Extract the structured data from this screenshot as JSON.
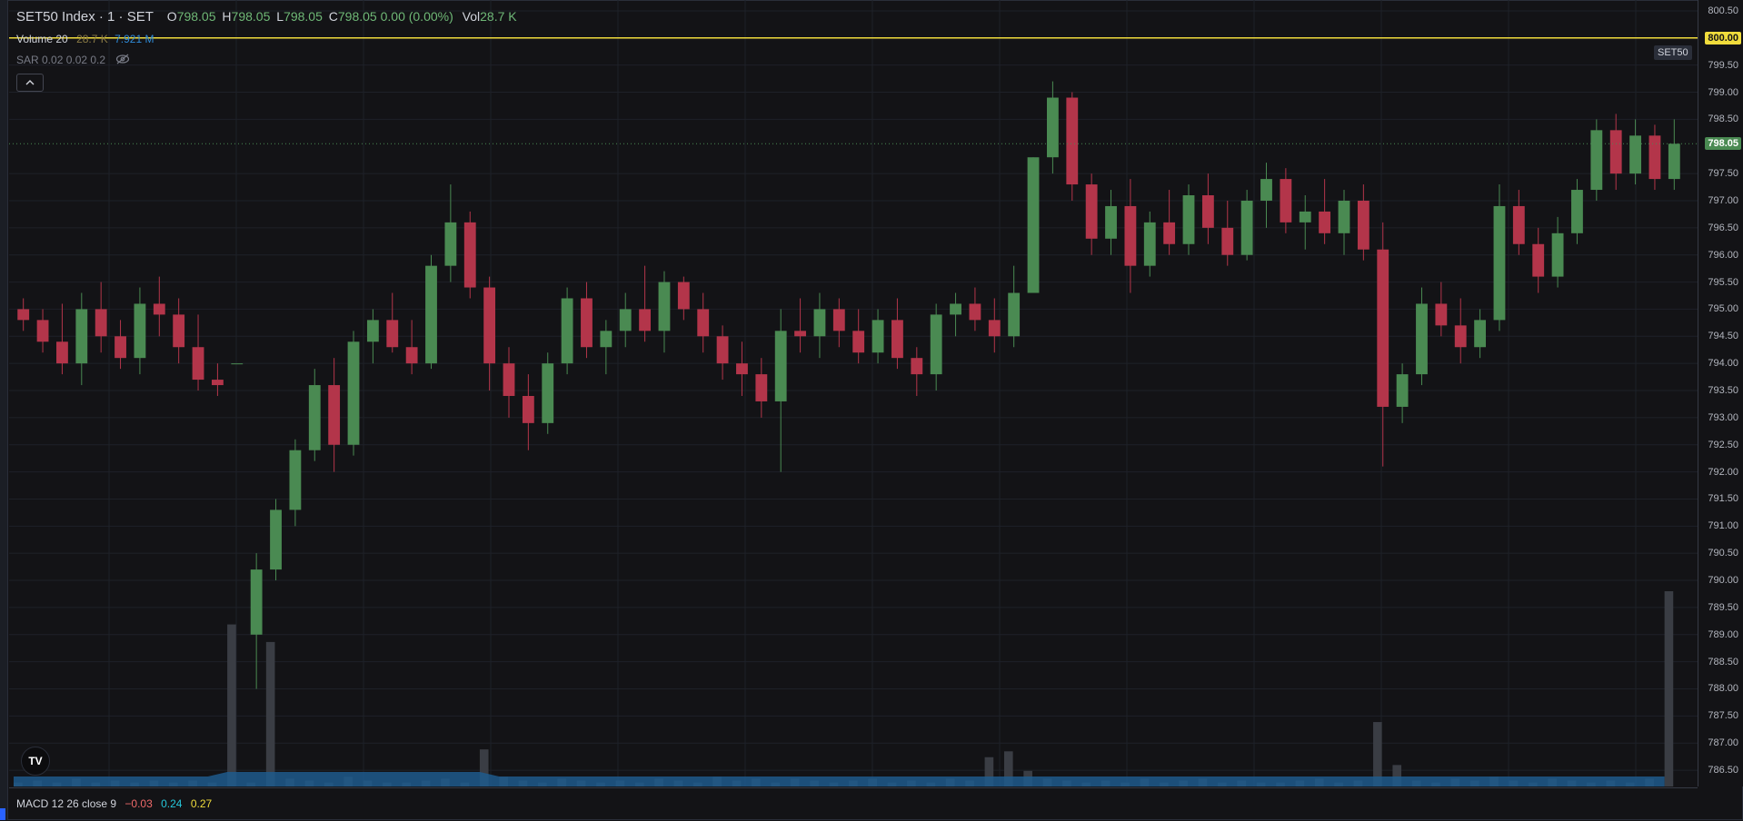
{
  "header": {
    "symbol": "SET50 Index · 1 · SET",
    "o_label": "O",
    "o_value": "798.05",
    "h_label": "H",
    "h_value": "798.05",
    "l_label": "L",
    "l_value": "798.05",
    "c_label": "C",
    "c_value": "798.05 0.00 (0.00%)",
    "vol_label": "Vol",
    "vol_value": "28.7 K"
  },
  "indicators": {
    "volume": {
      "label": "Volume 20",
      "value1": "28.7 K",
      "value2": "7.921 M"
    },
    "sar": {
      "label": "SAR 0.02 0.02 0.2",
      "icon": "eye-off-icon"
    },
    "collapse_icon": "chevron-up-icon",
    "macd": {
      "label": "MACD 12 26 close 9",
      "macd": "−0.03",
      "signal": "0.24",
      "histogram": "0.27"
    }
  },
  "symbol_badge": "SET50",
  "price_axis": {
    "ticks": [
      "800.50",
      "799.50",
      "799.00",
      "798.50",
      "797.50",
      "797.00",
      "796.50",
      "796.00",
      "795.50",
      "795.00",
      "794.50",
      "794.00",
      "793.50",
      "793.00",
      "792.50",
      "792.00",
      "791.50",
      "791.00",
      "790.50",
      "790.00",
      "789.50",
      "789.00",
      "788.50",
      "788.00",
      "787.50",
      "787.00",
      "786.50"
    ],
    "alert_price": "800.00",
    "last_price": "798.05"
  },
  "colors": {
    "background": "#131316",
    "up": "#4a8a52",
    "down": "#b3354a",
    "alert_line": "#f0dc3c",
    "volume_ma": "#1f5a8c",
    "volume_bar": "#3a3d44"
  },
  "logo": "TV",
  "chart_data": {
    "type": "candlestick",
    "interval": "1 minute",
    "yrange": [
      786.2,
      800.7
    ],
    "alert_level": 800.0,
    "last_close": 798.05,
    "candles_ohlc": [
      [
        795.0,
        795.2,
        794.6,
        794.8
      ],
      [
        794.8,
        795.0,
        794.2,
        794.4
      ],
      [
        794.4,
        795.1,
        793.8,
        794.0
      ],
      [
        794.0,
        795.3,
        793.6,
        795.0
      ],
      [
        795.0,
        795.5,
        794.2,
        794.5
      ],
      [
        794.5,
        794.8,
        793.9,
        794.1
      ],
      [
        794.1,
        795.4,
        793.8,
        795.1
      ],
      [
        795.1,
        795.6,
        794.5,
        794.9
      ],
      [
        794.9,
        795.2,
        794.0,
        794.3
      ],
      [
        794.3,
        794.9,
        793.5,
        793.7
      ],
      [
        793.7,
        794.0,
        793.4,
        793.6
      ],
      [
        794.0,
        794.0,
        794.0,
        794.0
      ],
      [
        789.0,
        790.5,
        788.0,
        790.2
      ],
      [
        790.2,
        791.5,
        790.0,
        791.3
      ],
      [
        791.3,
        792.6,
        791.0,
        792.4
      ],
      [
        792.4,
        793.9,
        792.2,
        793.6
      ],
      [
        793.6,
        794.1,
        792.0,
        792.5
      ],
      [
        792.5,
        794.6,
        792.3,
        794.4
      ],
      [
        794.4,
        795.0,
        794.0,
        794.8
      ],
      [
        794.8,
        795.3,
        794.2,
        794.3
      ],
      [
        794.3,
        794.8,
        793.8,
        794.0
      ],
      [
        794.0,
        796.0,
        793.9,
        795.8
      ],
      [
        795.8,
        797.3,
        795.5,
        796.6
      ],
      [
        796.6,
        796.8,
        795.2,
        795.4
      ],
      [
        795.4,
        795.6,
        793.5,
        794.0
      ],
      [
        794.0,
        794.3,
        793.0,
        793.4
      ],
      [
        793.4,
        793.8,
        792.4,
        792.9
      ],
      [
        792.9,
        794.2,
        792.7,
        794.0
      ],
      [
        794.0,
        795.4,
        793.8,
        795.2
      ],
      [
        795.2,
        795.5,
        794.1,
        794.3
      ],
      [
        794.3,
        794.8,
        793.8,
        794.6
      ],
      [
        794.6,
        795.3,
        794.3,
        795.0
      ],
      [
        795.0,
        795.8,
        794.4,
        794.6
      ],
      [
        794.6,
        795.7,
        794.2,
        795.5
      ],
      [
        795.5,
        795.6,
        794.8,
        795.0
      ],
      [
        795.0,
        795.3,
        794.2,
        794.5
      ],
      [
        794.5,
        794.7,
        793.7,
        794.0
      ],
      [
        794.0,
        794.4,
        793.4,
        793.8
      ],
      [
        793.8,
        794.1,
        793.0,
        793.3
      ],
      [
        793.3,
        795.0,
        792.0,
        794.6
      ],
      [
        794.6,
        795.2,
        794.2,
        794.5
      ],
      [
        794.5,
        795.3,
        794.1,
        795.0
      ],
      [
        795.0,
        795.2,
        794.3,
        794.6
      ],
      [
        794.6,
        795.0,
        794.0,
        794.2
      ],
      [
        794.2,
        795.0,
        794.0,
        794.8
      ],
      [
        794.8,
        795.2,
        793.9,
        794.1
      ],
      [
        794.1,
        794.3,
        793.4,
        793.8
      ],
      [
        793.8,
        795.1,
        793.5,
        794.9
      ],
      [
        794.9,
        795.3,
        794.5,
        795.1
      ],
      [
        795.1,
        795.4,
        794.6,
        794.8
      ],
      [
        794.8,
        795.2,
        794.2,
        794.5
      ],
      [
        794.5,
        795.8,
        794.3,
        795.3
      ],
      [
        795.3,
        795.5,
        796.9,
        797.8
      ],
      [
        797.8,
        799.2,
        797.5,
        798.9
      ],
      [
        798.9,
        799.0,
        797.0,
        797.3
      ],
      [
        797.3,
        797.5,
        796.0,
        796.3
      ],
      [
        796.3,
        797.2,
        796.0,
        796.9
      ],
      [
        796.9,
        797.4,
        795.3,
        795.8
      ],
      [
        795.8,
        796.8,
        795.6,
        796.6
      ],
      [
        796.6,
        797.2,
        796.0,
        796.2
      ],
      [
        796.2,
        797.3,
        796.0,
        797.1
      ],
      [
        797.1,
        797.5,
        796.2,
        796.5
      ],
      [
        796.5,
        797.0,
        795.8,
        796.0
      ],
      [
        796.0,
        797.2,
        795.9,
        797.0
      ],
      [
        797.0,
        797.7,
        796.5,
        797.4
      ],
      [
        797.4,
        797.6,
        796.4,
        796.6
      ],
      [
        796.6,
        797.1,
        796.1,
        796.8
      ],
      [
        796.8,
        797.4,
        796.2,
        796.4
      ],
      [
        796.4,
        797.2,
        796.0,
        797.0
      ],
      [
        797.0,
        797.3,
        795.9,
        796.1
      ],
      [
        796.1,
        796.6,
        792.1,
        793.2
      ],
      [
        793.2,
        794.0,
        792.9,
        793.8
      ],
      [
        793.8,
        795.4,
        793.6,
        795.1
      ],
      [
        795.1,
        795.5,
        794.5,
        794.7
      ],
      [
        794.7,
        795.2,
        794.0,
        794.3
      ],
      [
        794.3,
        795.0,
        794.1,
        794.8
      ],
      [
        794.8,
        797.3,
        794.6,
        796.9
      ],
      [
        796.9,
        797.2,
        796.0,
        796.2
      ],
      [
        796.2,
        796.5,
        795.3,
        795.6
      ],
      [
        795.6,
        796.7,
        795.4,
        796.4
      ],
      [
        796.4,
        797.4,
        796.2,
        797.2
      ],
      [
        797.2,
        798.5,
        797.0,
        798.3
      ],
      [
        798.3,
        798.6,
        797.2,
        797.5
      ],
      [
        797.5,
        798.5,
        797.3,
        798.2
      ],
      [
        798.2,
        798.4,
        797.2,
        797.4
      ],
      [
        797.4,
        798.5,
        797.2,
        798.05
      ]
    ],
    "volume_bars_relative": [
      0.02,
      0.03,
      0.02,
      0.04,
      0.02,
      0.03,
      0.02,
      0.03,
      0.02,
      0.03,
      0.02,
      0.83,
      0.02,
      0.74,
      0.04,
      0.03,
      0.02,
      0.05,
      0.03,
      0.02,
      0.02,
      0.03,
      0.04,
      0.02,
      0.19,
      0.05,
      0.03,
      0.02,
      0.04,
      0.03,
      0.02,
      0.03,
      0.02,
      0.04,
      0.03,
      0.02,
      0.05,
      0.03,
      0.04,
      0.02,
      0.04,
      0.03,
      0.02,
      0.03,
      0.04,
      0.02,
      0.03,
      0.02,
      0.04,
      0.03,
      0.15,
      0.18,
      0.08,
      0.04,
      0.03,
      0.02,
      0.03,
      0.02,
      0.04,
      0.02,
      0.03,
      0.04,
      0.02,
      0.03,
      0.02,
      0.02,
      0.03,
      0.04,
      0.02,
      0.03,
      0.33,
      0.11,
      0.03,
      0.02,
      0.04,
      0.03,
      0.05,
      0.03,
      0.02,
      0.04,
      0.03,
      0.02,
      0.03,
      0.02,
      0.04,
      1.0
    ]
  }
}
